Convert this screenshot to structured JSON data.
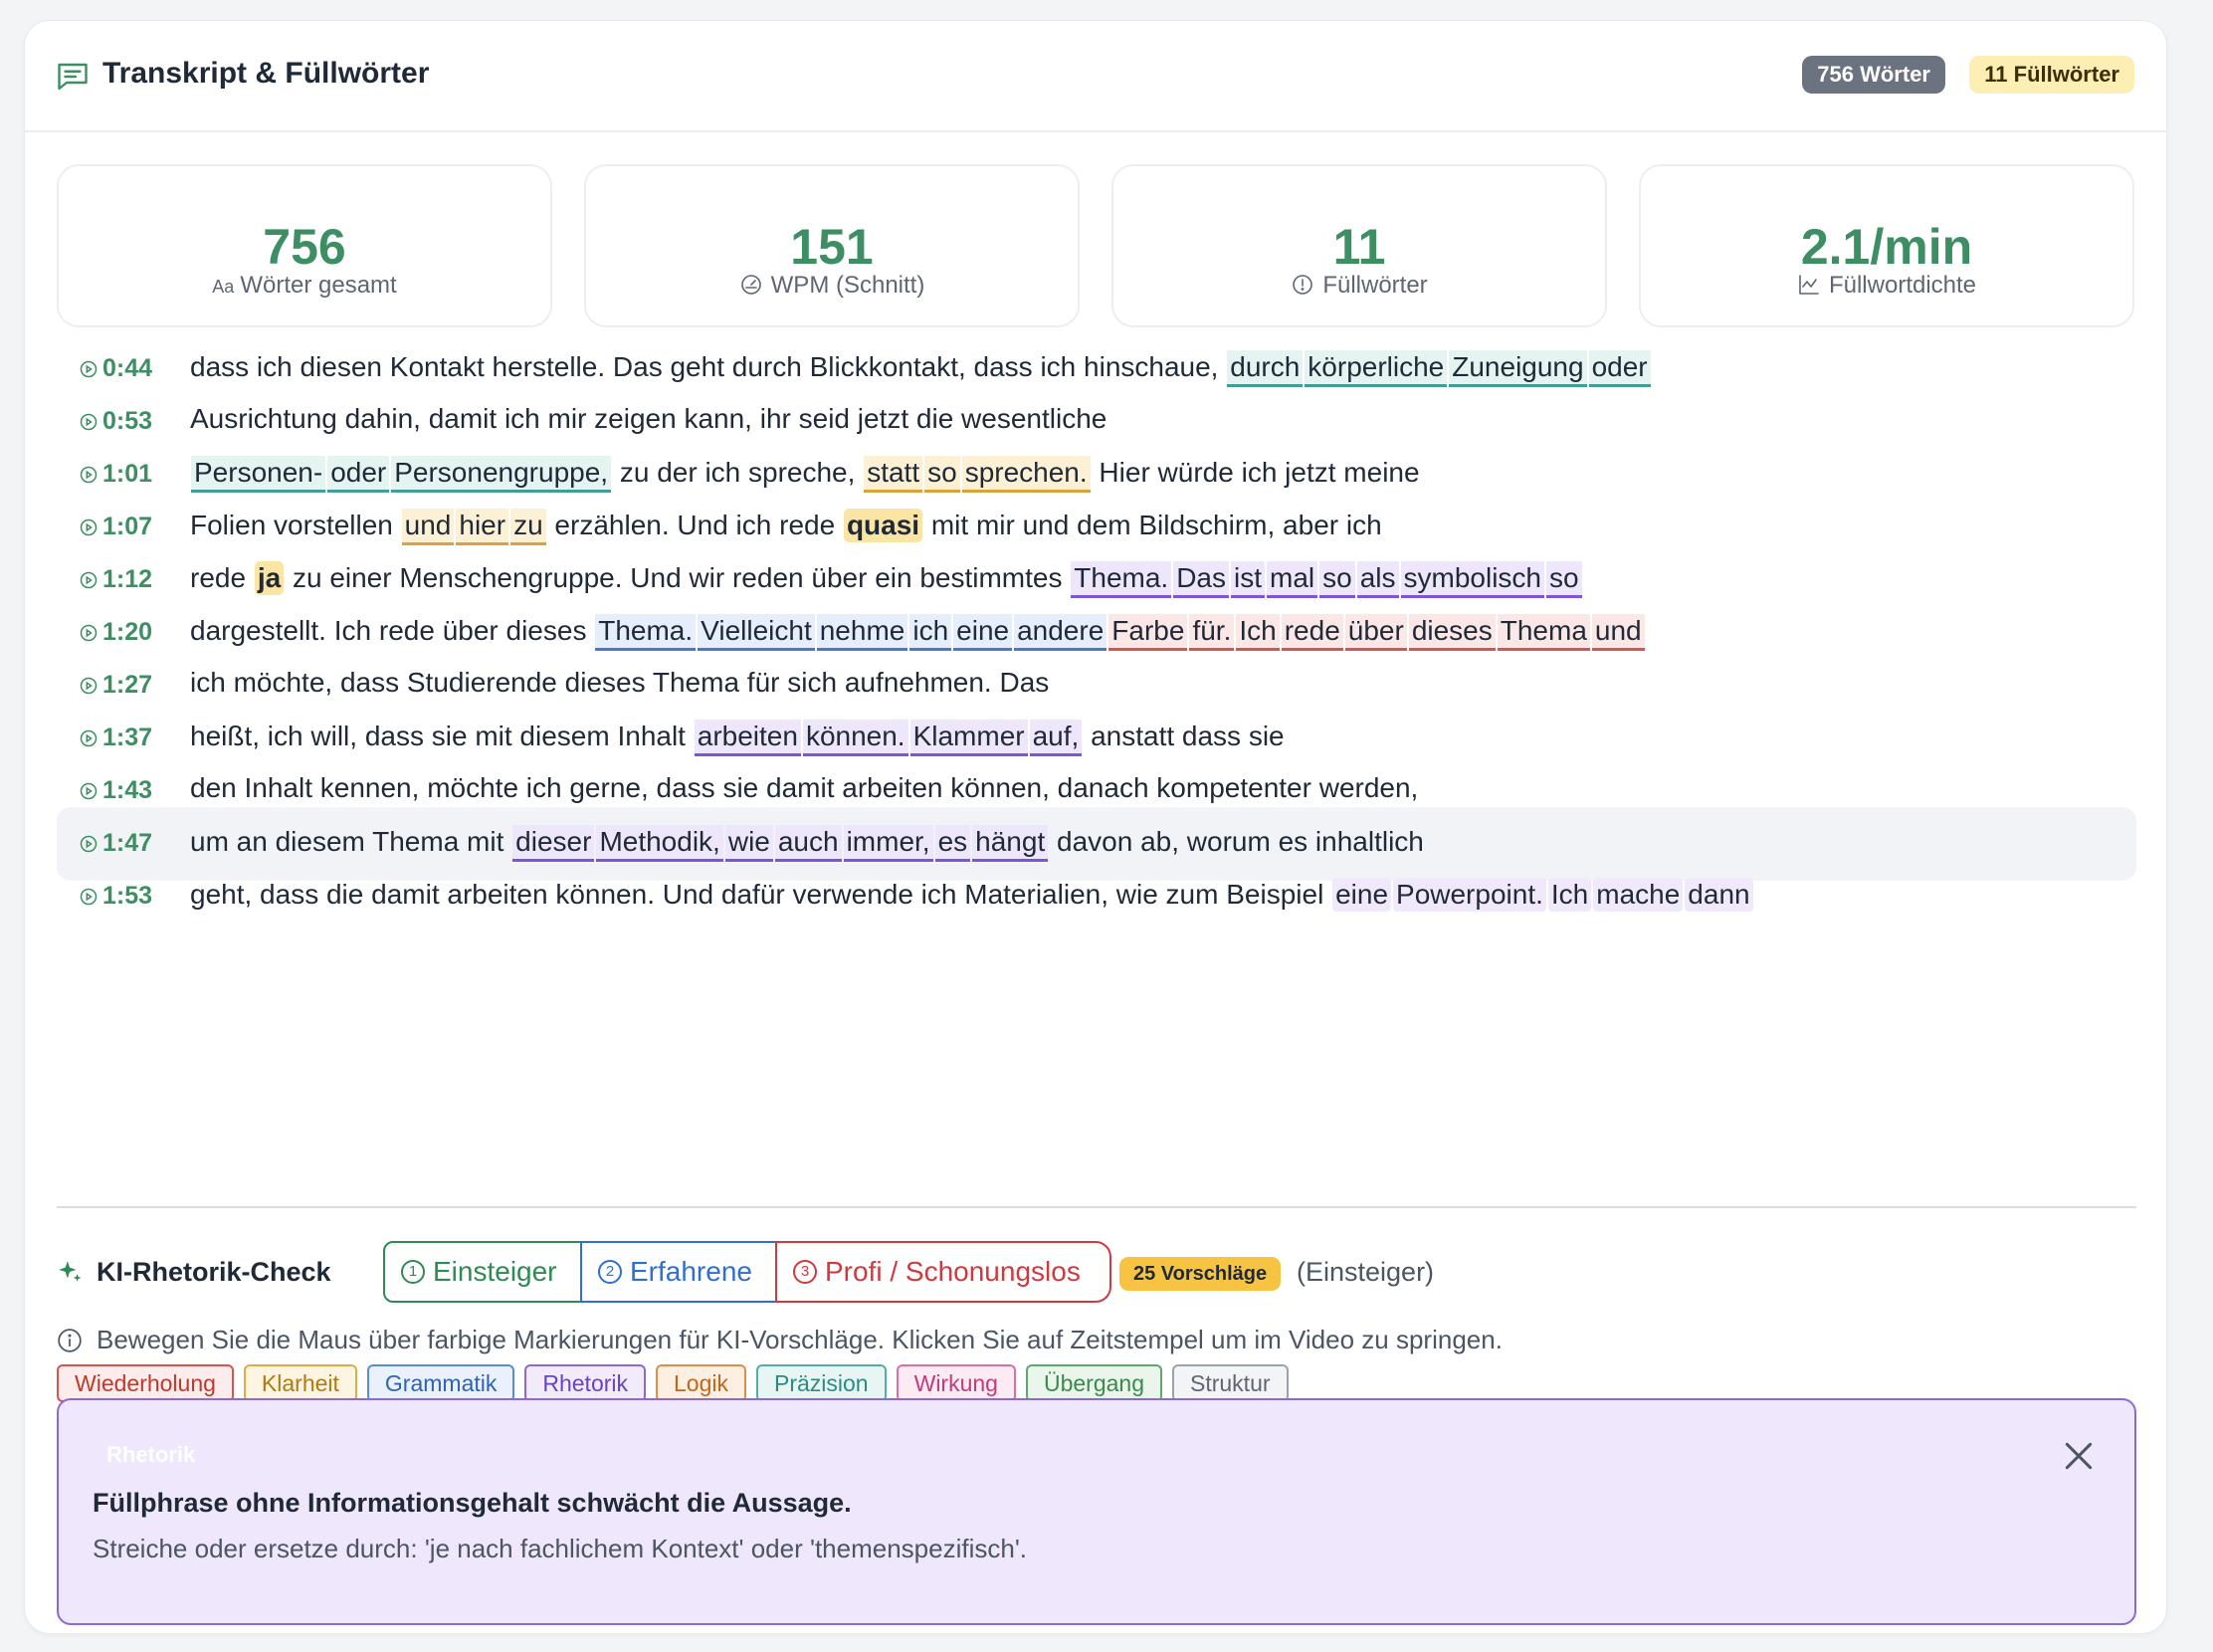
{
  "header": {
    "title": "Transkript & Füllwörter",
    "badge_words": "756 Wörter",
    "badge_fillers": "11 Füllwörter"
  },
  "stats": [
    {
      "value": "756",
      "label": "Wörter gesamt",
      "icon": "text-size-icon"
    },
    {
      "value": "151",
      "label": "WPM (Schnitt)",
      "icon": "speedometer-icon"
    },
    {
      "value": "11",
      "label": "Füllwörter",
      "icon": "alert-circle-icon"
    },
    {
      "value": "2.1/min",
      "label": "Füllwortdichte",
      "icon": "line-chart-icon"
    }
  ],
  "stats_aa_glyph": "Aa",
  "transcript": {
    "rows": [
      {
        "ts": "0:44",
        "segments": [
          {
            "t": "dass ich diesen Kontakt herstelle. Das geht durch Blickkontakt, dass ich hinschaue, "
          },
          {
            "t": "durch",
            "c": "t"
          },
          {
            "t": "körperliche",
            "c": "t"
          },
          {
            "t": "Zuneigung",
            "c": "t"
          },
          {
            "t": "oder",
            "c": "t"
          }
        ]
      },
      {
        "ts": "0:53",
        "segments": [
          {
            "t": "Ausrichtung dahin, damit ich mir zeigen kann, ihr seid jetzt die wesentliche"
          }
        ]
      },
      {
        "ts": "1:01",
        "segments": [
          {
            "t": "Personen-",
            "c": "t"
          },
          {
            "t": "oder",
            "c": "t"
          },
          {
            "t": "Personengruppe,",
            "c": "t"
          },
          {
            "t": " zu der ich spreche, "
          },
          {
            "t": "statt",
            "c": "y"
          },
          {
            "t": "so",
            "c": "y"
          },
          {
            "t": "sprechen.",
            "c": "y"
          },
          {
            "t": " Hier würde ich jetzt meine"
          }
        ]
      },
      {
        "ts": "1:07",
        "segments": [
          {
            "t": "Folien vorstellen "
          },
          {
            "t": "und",
            "c": "y"
          },
          {
            "t": "hier",
            "c": "y"
          },
          {
            "t": "zu",
            "c": "y"
          },
          {
            "t": " erzählen. Und ich rede "
          },
          {
            "t": "quasi",
            "c": "ys"
          },
          {
            "t": " mit mir und dem Bildschirm, aber ich"
          }
        ]
      },
      {
        "ts": "1:12",
        "segments": [
          {
            "t": "rede "
          },
          {
            "t": "ja",
            "c": "ys"
          },
          {
            "t": " zu einer Menschengruppe. Und wir reden über ein bestimmtes "
          },
          {
            "t": "Thema.",
            "c": "p"
          },
          {
            "t": "Das",
            "c": "p"
          },
          {
            "t": "ist",
            "c": "p"
          },
          {
            "t": "mal",
            "c": "p"
          },
          {
            "t": "so",
            "c": "p"
          },
          {
            "t": "als",
            "c": "p"
          },
          {
            "t": "symbolisch",
            "c": "p"
          },
          {
            "t": "so",
            "c": "p"
          }
        ]
      },
      {
        "ts": "1:20",
        "segments": [
          {
            "t": "dargestellt. Ich rede über dieses "
          },
          {
            "t": "Thema.",
            "c": "b"
          },
          {
            "t": "Vielleicht",
            "c": "b"
          },
          {
            "t": "nehme",
            "c": "b"
          },
          {
            "t": "ich",
            "c": "b"
          },
          {
            "t": "eine",
            "c": "b"
          },
          {
            "t": "andere",
            "c": "b"
          },
          {
            "t": "Farbe",
            "c": "r"
          },
          {
            "t": "für.",
            "c": "r"
          },
          {
            "t": "Ich",
            "c": "r"
          },
          {
            "t": "rede",
            "c": "r"
          },
          {
            "t": "über",
            "c": "r"
          },
          {
            "t": "dieses",
            "c": "r"
          },
          {
            "t": "Thema",
            "c": "r"
          },
          {
            "t": "und",
            "c": "r"
          }
        ]
      },
      {
        "ts": "1:27",
        "segments": [
          {
            "t": "ich möchte, dass Studierende dieses Thema für sich aufnehmen. Das"
          }
        ]
      },
      {
        "ts": "1:37",
        "segments": [
          {
            "t": "heißt, ich will, dass sie mit diesem Inhalt "
          },
          {
            "t": "arbeiten",
            "c": "p"
          },
          {
            "t": "können.",
            "c": "p"
          },
          {
            "t": "Klammer",
            "c": "p"
          },
          {
            "t": "auf,",
            "c": "p"
          },
          {
            "t": " anstatt dass sie"
          }
        ]
      },
      {
        "ts": "1:43",
        "segments": [
          {
            "t": "den Inhalt kennen, möchte ich gerne, dass sie damit arbeiten können, danach kompetenter werden,"
          }
        ]
      },
      {
        "ts": "1:47",
        "highlighted": true,
        "segments": [
          {
            "t": "um an diesem Thema mit "
          },
          {
            "t": "dieser",
            "c": "p"
          },
          {
            "t": "Methodik,",
            "c": "p"
          },
          {
            "t": "wie",
            "c": "p"
          },
          {
            "t": "auch",
            "c": "p"
          },
          {
            "t": "immer,",
            "c": "p"
          },
          {
            "t": "es",
            "c": "p"
          },
          {
            "t": "hängt",
            "c": "p"
          },
          {
            "t": " davon ab, worum es inhaltlich"
          }
        ]
      },
      {
        "ts": "1:53",
        "segments": [
          {
            "t": "geht, dass die damit arbeiten können. Und dafür verwende ich Materialien, wie zum Beispiel "
          },
          {
            "t": "eine",
            "c": "pl"
          },
          {
            "t": "Powerpoint.",
            "c": "pl"
          },
          {
            "t": "Ich",
            "c": "pl"
          },
          {
            "t": "mache",
            "c": "pl"
          },
          {
            "t": "dann",
            "c": "pl"
          }
        ]
      }
    ]
  },
  "ki": {
    "title": "KI-Rhetorik-Check",
    "levels": [
      {
        "num": "1",
        "label": "Einsteiger"
      },
      {
        "num": "2",
        "label": "Erfahrene"
      },
      {
        "num": "3",
        "label": "Profi / Schonungslos"
      }
    ],
    "count_badge": "25 Vorschläge",
    "level_hint": "(Einsteiger)",
    "info": "Bewegen Sie die Maus über farbige Markierungen für KI-Vorschläge. Klicken Sie auf Zeitstempel um im Video zu springen.",
    "categories": [
      "Wiederholung",
      "Klarheit",
      "Grammatik",
      "Rhetorik",
      "Logik",
      "Präzision",
      "Wirkung",
      "Übergang",
      "Struktur"
    ]
  },
  "popup": {
    "category": "Rhetorik",
    "title": "Füllphrase ohne Informationsgehalt schwächt die Aussage.",
    "body": "Streiche oder ersetze durch: 'je nach fachlichem Kontext' oder 'themenspezifisch'."
  },
  "colors": {
    "accent_green": "#3d8f63",
    "teal": "#3f9f96",
    "yellow": "#d9a23a",
    "purple": "#7b56d6",
    "blue": "#4a78c8",
    "red": "#d9534f"
  }
}
